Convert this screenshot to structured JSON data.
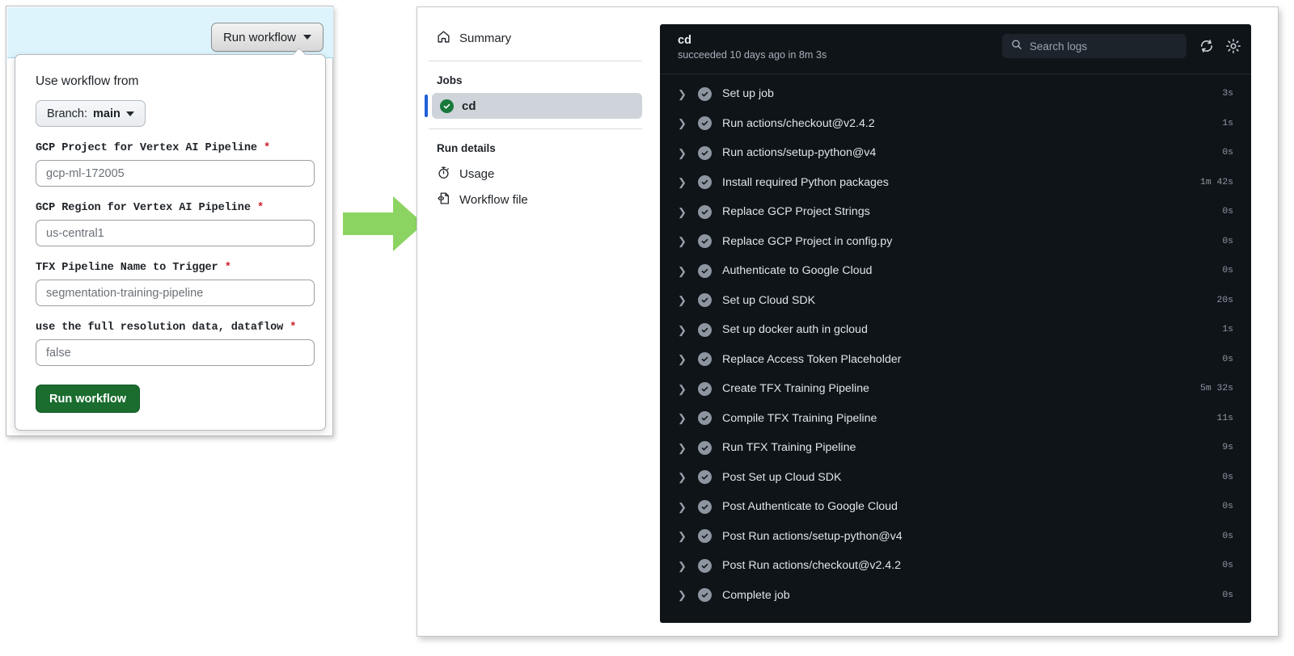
{
  "left_panel": {
    "run_workflow_button": "Run workflow",
    "popover": {
      "use_workflow_from": "Use workflow from",
      "branch_prefix": "Branch:",
      "branch_name": "main",
      "submit_label": "Run workflow",
      "required_marker": "*",
      "fields": [
        {
          "label": "GCP Project for Vertex AI Pipeline",
          "value": "gcp-ml-172005",
          "required": true
        },
        {
          "label": "GCP Region for Vertex AI Pipeline",
          "value": "us-central1",
          "required": true
        },
        {
          "label": "TFX Pipeline Name to Trigger",
          "value": "segmentation-training-pipeline",
          "required": true
        },
        {
          "label": "use the full resolution data, dataflow",
          "value": "false",
          "required": true
        }
      ]
    }
  },
  "arrow": {
    "icon": "right-arrow-icon",
    "color": "#8cd461"
  },
  "right_panel": {
    "sidebar": {
      "summary_label": "Summary",
      "summary_icon": "home-icon",
      "jobs_heading": "Jobs",
      "job": {
        "name": "cd",
        "status_icon": "check-circle-icon",
        "status": "success"
      },
      "run_details_heading": "Run details",
      "run_details_items": [
        {
          "label": "Usage",
          "icon": "stopwatch-icon"
        },
        {
          "label": "Workflow file",
          "icon": "file-code-icon"
        }
      ]
    },
    "logs": {
      "job_title": "cd",
      "job_subtitle": "succeeded 10 days ago in 8m 3s",
      "search_placeholder": "Search logs",
      "search_value": "",
      "search_icon": "search-icon",
      "refresh_icon": "refresh-icon",
      "settings_icon": "gear-icon",
      "steps": [
        {
          "name": "Set up job",
          "duration": "3s"
        },
        {
          "name": "Run actions/checkout@v2.4.2",
          "duration": "1s"
        },
        {
          "name": "Run actions/setup-python@v4",
          "duration": "0s"
        },
        {
          "name": "Install required Python packages",
          "duration": "1m 42s"
        },
        {
          "name": "Replace GCP Project Strings",
          "duration": "0s"
        },
        {
          "name": "Replace GCP Project in config.py",
          "duration": "0s"
        },
        {
          "name": "Authenticate to Google Cloud",
          "duration": "0s"
        },
        {
          "name": "Set up Cloud SDK",
          "duration": "20s"
        },
        {
          "name": "Set up docker auth in gcloud",
          "duration": "1s"
        },
        {
          "name": "Replace Access Token Placeholder",
          "duration": "0s"
        },
        {
          "name": "Create TFX Training Pipeline",
          "duration": "5m 32s"
        },
        {
          "name": "Compile TFX Training Pipeline",
          "duration": "11s"
        },
        {
          "name": "Run TFX Training Pipeline",
          "duration": "9s"
        },
        {
          "name": "Post Set up Cloud SDK",
          "duration": "0s"
        },
        {
          "name": "Post Authenticate to Google Cloud",
          "duration": "0s"
        },
        {
          "name": "Post Run actions/setup-python@v4",
          "duration": "0s"
        },
        {
          "name": "Post Run actions/checkout@v2.4.2",
          "duration": "0s"
        },
        {
          "name": "Complete job",
          "duration": "0s"
        }
      ]
    }
  }
}
